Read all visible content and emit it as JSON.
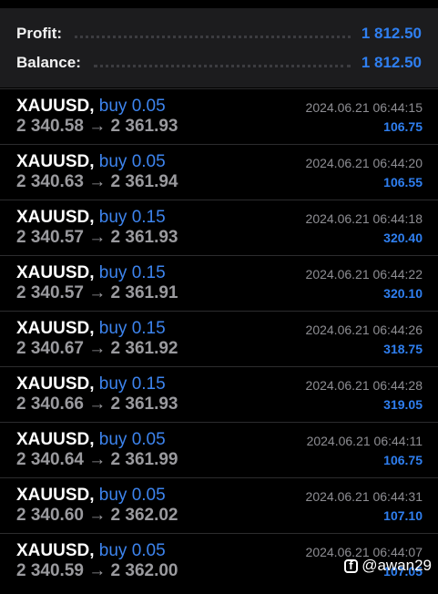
{
  "summary": {
    "profit_label": "Profit:",
    "profit_value": "1 812.50",
    "balance_label": "Balance:",
    "balance_value": "1 812.50"
  },
  "trades": [
    {
      "symbol": "XAUUSD,",
      "side": "buy 0.05",
      "open": "2 340.58",
      "arrow": "→",
      "close": "2 361.93",
      "time": "2024.06.21 06:44:15",
      "profit": "106.75"
    },
    {
      "symbol": "XAUUSD,",
      "side": "buy 0.05",
      "open": "2 340.63",
      "arrow": "→",
      "close": "2 361.94",
      "time": "2024.06.21 06:44:20",
      "profit": "106.55"
    },
    {
      "symbol": "XAUUSD,",
      "side": "buy 0.15",
      "open": "2 340.57",
      "arrow": "→",
      "close": "2 361.93",
      "time": "2024.06.21 06:44:18",
      "profit": "320.40"
    },
    {
      "symbol": "XAUUSD,",
      "side": "buy 0.15",
      "open": "2 340.57",
      "arrow": "→",
      "close": "2 361.91",
      "time": "2024.06.21 06:44:22",
      "profit": "320.10"
    },
    {
      "symbol": "XAUUSD,",
      "side": "buy 0.15",
      "open": "2 340.67",
      "arrow": "→",
      "close": "2 361.92",
      "time": "2024.06.21 06:44:26",
      "profit": "318.75"
    },
    {
      "symbol": "XAUUSD,",
      "side": "buy 0.15",
      "open": "2 340.66",
      "arrow": "→",
      "close": "2 361.93",
      "time": "2024.06.21 06:44:28",
      "profit": "319.05"
    },
    {
      "symbol": "XAUUSD,",
      "side": "buy 0.05",
      "open": "2 340.64",
      "arrow": "→",
      "close": "2 361.99",
      "time": "2024.06.21 06:44:11",
      "profit": "106.75"
    },
    {
      "symbol": "XAUUSD,",
      "side": "buy 0.05",
      "open": "2 340.60",
      "arrow": "→",
      "close": "2 362.02",
      "time": "2024.06.21 06:44:31",
      "profit": "107.10"
    },
    {
      "symbol": "XAUUSD,",
      "side": "buy 0.05",
      "open": "2 340.59",
      "arrow": "→",
      "close": "2 362.00",
      "time": "2024.06.21 06:44:07",
      "profit": "107.05"
    }
  ],
  "watermark": {
    "text": "@awan29",
    "icon": "facebook-icon"
  },
  "colors": {
    "background": "#000000",
    "summary_bg": "#1c1c1e",
    "accent": "#2f7ff0",
    "muted": "#9a9a9e"
  }
}
